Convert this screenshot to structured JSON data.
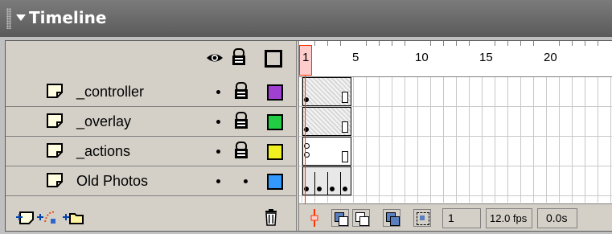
{
  "panel": {
    "title": "Timeline"
  },
  "header_icons": [
    "eye-icon",
    "lock-icon",
    "outline-icon"
  ],
  "layers": [
    {
      "name": "_controller",
      "locked": true,
      "color": "#a040d0"
    },
    {
      "name": "_overlay",
      "locked": true,
      "color": "#22cc44"
    },
    {
      "name": "_actions",
      "locked": true,
      "color": "#f0f020"
    },
    {
      "name": "Old Photos",
      "locked": false,
      "color": "#3399ff"
    }
  ],
  "ruler": {
    "labels": [
      "1",
      "5",
      "10",
      "15",
      "20"
    ]
  },
  "status": {
    "current_frame": "1",
    "frame_rate": "12.0 fps",
    "elapsed_time": "0.0s"
  },
  "layer_toolbar_icons": [
    "insert-layer-icon",
    "add-motion-guide-icon",
    "insert-folder-icon",
    "trash-icon"
  ],
  "timeline_toolbar_icons": [
    "center-frame-icon",
    "onion-skin-icon",
    "onion-skin-outlines-icon",
    "edit-multiple-frames-icon",
    "modify-onion-markers-icon"
  ]
}
